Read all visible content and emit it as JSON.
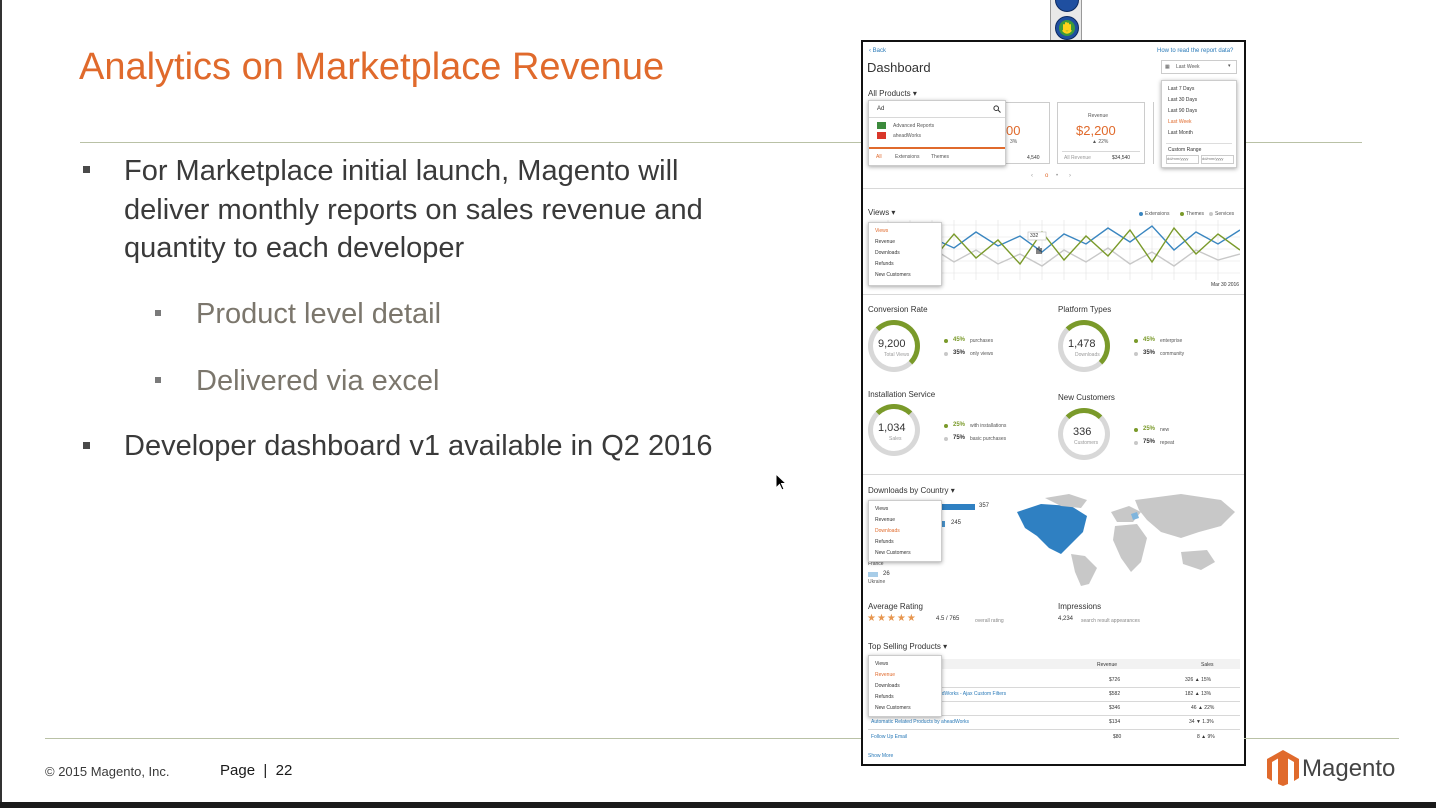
{
  "slide": {
    "title": "Analytics on Marketplace Revenue",
    "bullets": [
      {
        "lines": [
          "For Marketplace initial launch, Magento will",
          "deliver monthly reports on sales revenue and",
          "quantity to each developer"
        ]
      },
      {
        "text": "Product level detail"
      },
      {
        "text": "Delivered via excel"
      },
      {
        "lines": [
          "Developer dashboard v1 available in Q2 2016"
        ]
      }
    ],
    "footer": {
      "copyright": "© 2015 Magento, Inc.",
      "page": "Page  |  22"
    },
    "logo_text": "Magento"
  },
  "dashboard": {
    "back": "‹ Back",
    "help_link": "How to read the report data?",
    "title": "Dashboard",
    "date_select": "Last Week",
    "date_options": [
      "Last 7 Days",
      "Last 30 Days",
      "Last 90 Days",
      "Last Week",
      "Last Month"
    ],
    "custom_range": "Custom Range",
    "range_from": "dd/mm/yyyy",
    "range_to": "dd/mm/yyyy",
    "all_products": "All Products ▾",
    "search_value": "Ad",
    "search_results": [
      "Advanced Reports",
      "aheadWorks"
    ],
    "filter_tabs": [
      "All",
      "Extensions",
      "Themes"
    ],
    "stat_partial_value": "00",
    "stat_partial_sub": "3%",
    "stat_left_total": "4,540",
    "revenue_label": "Revenue",
    "revenue_value": "$2,200",
    "revenue_change": "▲ 22%",
    "revenue_footer_label": "All Revenue",
    "revenue_footer_value": "$34,540",
    "pager": [
      "‹",
      "o",
      "•",
      "›"
    ],
    "views_label": "Views ▾",
    "legend": [
      "Extensions",
      "Themes",
      "Services"
    ],
    "legend_colors": [
      "#3a86c0",
      "#7a9a2a",
      "#c8c8c8"
    ],
    "metric_options": [
      "Views",
      "Revenue",
      "Downloads",
      "Refunds",
      "New Customers"
    ],
    "tooltip_value": "332",
    "x_end_label": "Mar 30 2016",
    "conversion": {
      "title": "Conversion Rate",
      "value": "9,200",
      "sub": "Total Views",
      "p1": "45%",
      "t1": "purchases",
      "p2": "35%",
      "t2": "only views"
    },
    "platform": {
      "title": "Platform Types",
      "value": "1,478",
      "sub": "Downloads",
      "p1": "45%",
      "t1": "enterprise",
      "p2": "35%",
      "t2": "community"
    },
    "install": {
      "title": "Installation Service",
      "value": "1,034",
      "sub": "Sales",
      "p1": "25%",
      "t1": "with installations",
      "p2": "75%",
      "t2": "basic purchases"
    },
    "newcust": {
      "title": "New Customers",
      "value": "336",
      "sub": "Customers",
      "p1": "25%",
      "t1": "new",
      "p2": "75%",
      "t2": "repeat"
    },
    "downloads_by_country": "Downloads by Country ▾",
    "country_values": [
      "357",
      "245",
      "26"
    ],
    "country_names": [
      "France",
      "Ukraine"
    ],
    "avg_rating_title": "Average Rating",
    "avg_rating_value": "4.5 / 765",
    "avg_rating_note": "overall rating",
    "rating_stars": 4.5,
    "impressions_title": "Impressions",
    "impressions_value": "4,234",
    "impressions_note": "search result appearances",
    "top_selling": "Top Selling Products ▾",
    "table_headers": [
      "Revenue",
      "Sales"
    ],
    "rows": [
      {
        "name": "sion",
        "revenue": "$726",
        "sales": "326 ▲ 15%"
      },
      {
        "name": "adWorks - Ajax Custom Filters",
        "revenue": "$582",
        "sales": "182 ▲ 13%"
      },
      {
        "name": "",
        "revenue": "$346",
        "sales": "46 ▲ 22%"
      },
      {
        "name": "Automatic Related Products by aheadWorks",
        "revenue": "$134",
        "sales": "34 ▼ 1.3%"
      },
      {
        "name": "Follow Up Email",
        "revenue": "$80",
        "sales": "8 ▲ 9%"
      }
    ],
    "show_more": "Show More",
    "colors": {
      "accent": "#e06a2c",
      "link": "#2a7ab8",
      "green": "#7a9a2a",
      "bar": "#2f80c2"
    }
  }
}
